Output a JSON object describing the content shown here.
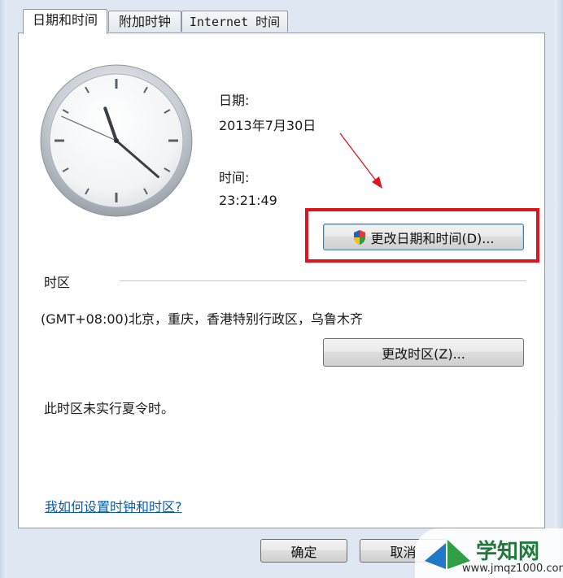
{
  "tabs": [
    {
      "label": "日期和时间",
      "active": true
    },
    {
      "label": "附加时钟",
      "active": false
    },
    {
      "label": "Internet 时间",
      "active": false
    }
  ],
  "clock": {
    "hour": 23,
    "minute": 21,
    "second": 49
  },
  "date": {
    "label": "日期:",
    "value": "2013年7月30日"
  },
  "time": {
    "label": "时间:",
    "value": "23:21:49"
  },
  "buttons": {
    "change_datetime": "更改日期和时间(D)...",
    "change_timezone": "更改时区(Z)...",
    "ok": "确定",
    "cancel": "取消"
  },
  "timezone": {
    "section_label": "时区",
    "value": "(GMT+08:00)北京，重庆，香港特别行政区，乌鲁木齐",
    "dst_note": "此时区未实行夏令时。"
  },
  "help_link": "我如何设置时钟和时区?",
  "annotation": {
    "highlight_color": "#e0141e"
  },
  "watermark": {
    "title": "学知网",
    "url": "www.jmqz1000.com"
  },
  "icons": {
    "shield": "uac-shield-icon"
  }
}
